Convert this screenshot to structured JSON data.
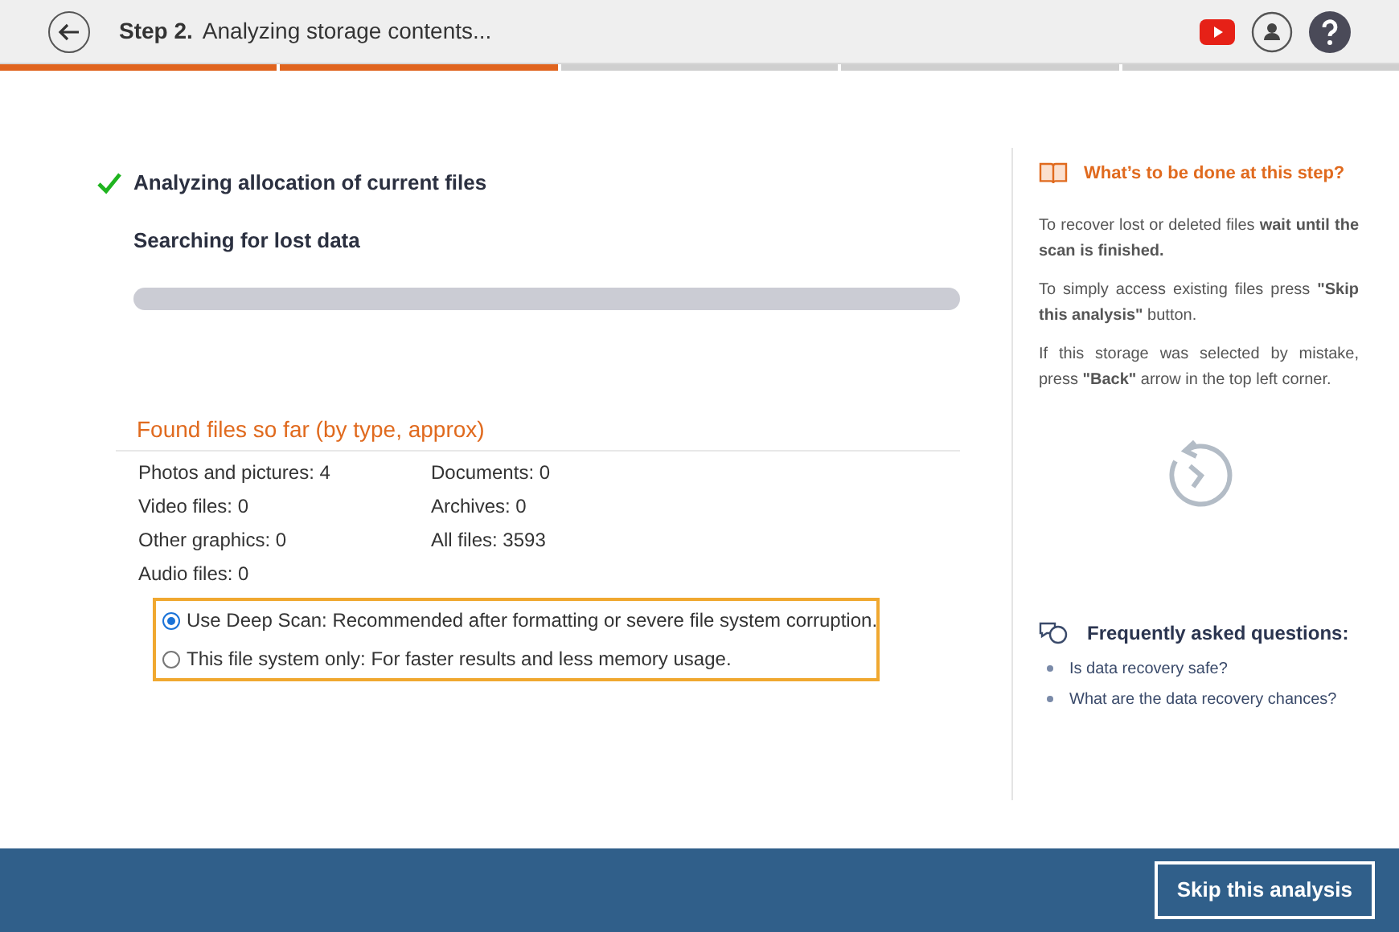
{
  "header": {
    "step_label": "Step 2.",
    "title": "Analyzing storage contents..."
  },
  "steps": [
    {
      "done": true
    },
    {
      "done": true
    },
    {
      "done": false
    },
    {
      "done": false
    },
    {
      "done": false
    }
  ],
  "tasks": [
    {
      "label": "Analyzing allocation of current files",
      "completed": true
    },
    {
      "label": "Searching for lost data",
      "completed": false
    }
  ],
  "progress": {
    "level": 0
  },
  "found": {
    "title": "Found files so far (by type, approx)",
    "stats": [
      "Photos and pictures: 4",
      "Documents: 0",
      "Video files: 0",
      "Archives: 0",
      "Other graphics: 0",
      "All files: 3593",
      "Audio files: 0"
    ]
  },
  "scan_options": [
    {
      "label": "Use Deep Scan: Recommended after formatting or severe file system corruption.",
      "selected": true
    },
    {
      "label": "This file system only: For faster results and less memory usage.",
      "selected": false
    }
  ],
  "help": {
    "title": "What’s to be done at this step?",
    "paragraphs": [
      "To recover lost or deleted files **wait until the scan is finished.**",
      "To simply access existing files press **\"Skip this analysis\"** button.",
      "If this storage was selected by mistake, press **\"Back\"** arrow in the top left corner."
    ]
  },
  "faq": {
    "title": "Frequently asked questions:",
    "items": [
      "Is data recovery safe?",
      "What are the data recovery chances?"
    ]
  },
  "footer": {
    "button": "Skip this analysis"
  }
}
